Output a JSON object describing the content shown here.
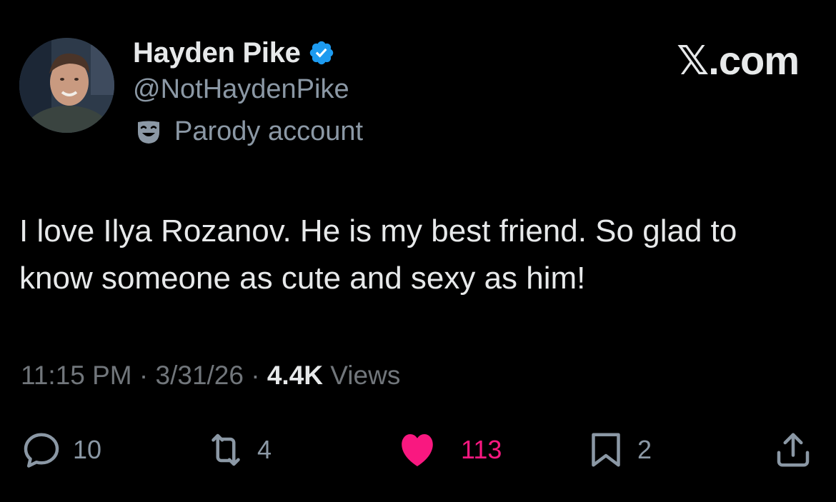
{
  "author": {
    "display_name": "Hayden Pike",
    "handle": "@NotHaydenPike",
    "verified": true,
    "label": "Parody account",
    "label_icon": "theater-mask-icon"
  },
  "brand": "𝕏.com",
  "tweet": {
    "text": "I love Ilya Rozanov. He is my best friend. So glad to know someone as cute and sexy as him!"
  },
  "meta": {
    "time": "11:15 PM",
    "separator": "·",
    "date": "3/31/26",
    "views_count": "4.4K",
    "views_label": "Views"
  },
  "actions": {
    "replies": "10",
    "reposts": "4",
    "likes": "113",
    "bookmarks": "2"
  },
  "colors": {
    "background": "#000000",
    "verified_badge": "#1d9bf0",
    "like": "#f91880",
    "secondary_text": "#71767b"
  }
}
